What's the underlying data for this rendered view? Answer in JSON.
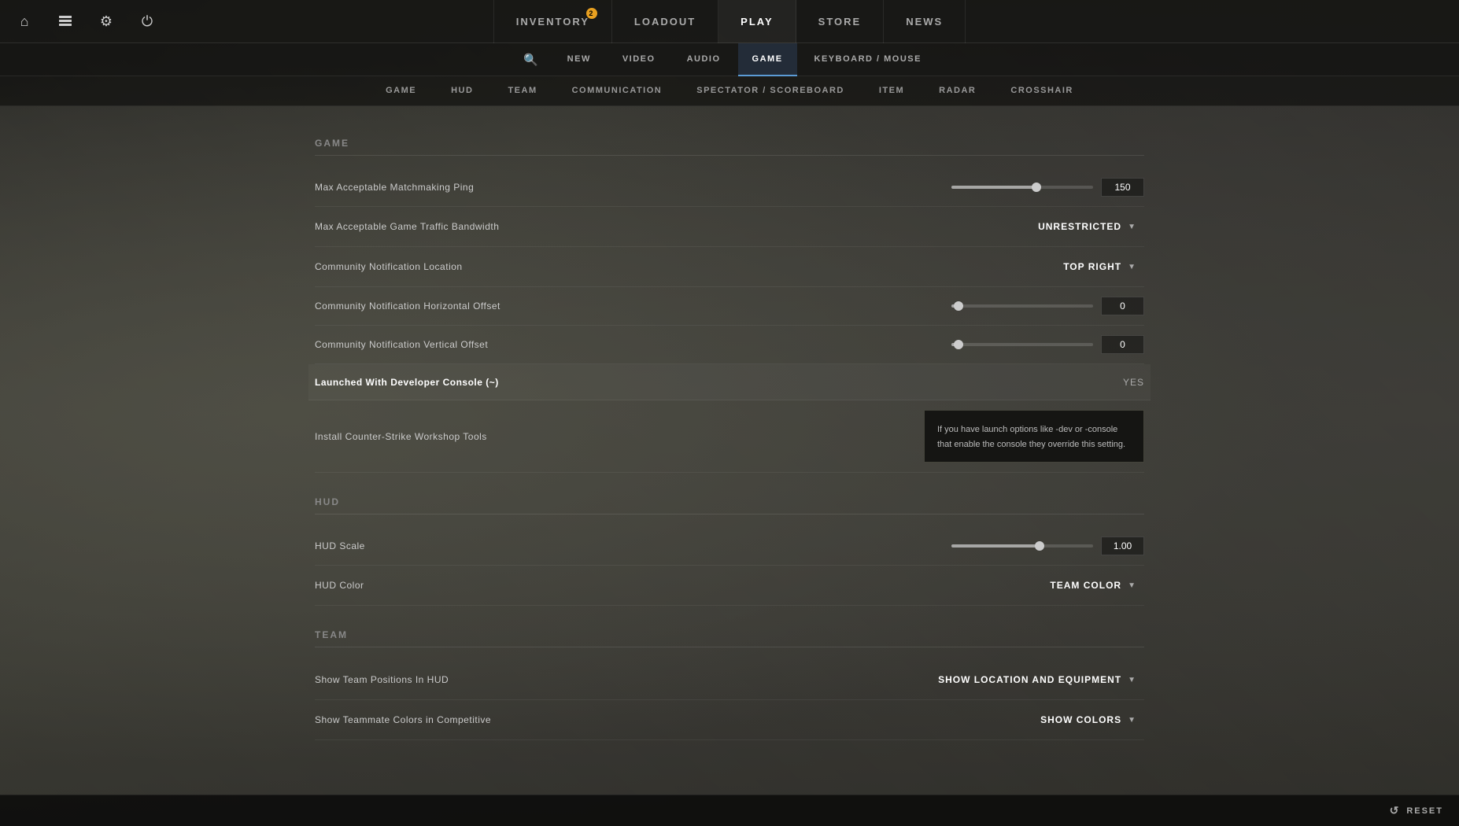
{
  "background": {
    "color": "#4a4948"
  },
  "top_nav": {
    "items": [
      {
        "id": "inventory",
        "label": "INVENTORY",
        "active": false,
        "badge": "2"
      },
      {
        "id": "loadout",
        "label": "LOADOUT",
        "active": false,
        "badge": null
      },
      {
        "id": "play",
        "label": "PLAY",
        "active": true,
        "badge": null
      },
      {
        "id": "store",
        "label": "STORE",
        "active": false,
        "badge": null
      },
      {
        "id": "news",
        "label": "NEWS",
        "active": false,
        "badge": null
      }
    ],
    "icons": {
      "home": "⌂",
      "clipboard": "📋",
      "gear": "⚙",
      "power": "⏻"
    }
  },
  "settings_tabs": {
    "items": [
      {
        "id": "new",
        "label": "NEW",
        "active": false
      },
      {
        "id": "video",
        "label": "VIDEO",
        "active": false
      },
      {
        "id": "audio",
        "label": "AUDIO",
        "active": false
      },
      {
        "id": "game",
        "label": "GAME",
        "active": true
      },
      {
        "id": "keyboard_mouse",
        "label": "KEYBOARD / MOUSE",
        "active": false
      }
    ],
    "search_icon": "🔍"
  },
  "sub_nav": {
    "items": [
      {
        "id": "game",
        "label": "GAME",
        "active": false
      },
      {
        "id": "hud",
        "label": "HUD",
        "active": false
      },
      {
        "id": "team",
        "label": "TEAM",
        "active": false
      },
      {
        "id": "communication",
        "label": "COMMUNICATION",
        "active": false
      },
      {
        "id": "spectator_scoreboard",
        "label": "SPECTATOR / SCOREBOARD",
        "active": false
      },
      {
        "id": "item",
        "label": "ITEM",
        "active": false
      },
      {
        "id": "radar",
        "label": "RADAR",
        "active": false
      },
      {
        "id": "crosshair",
        "label": "CROSSHAIR",
        "active": false
      }
    ]
  },
  "sections": {
    "game": {
      "label": "Game",
      "settings": [
        {
          "id": "matchmaking_ping",
          "name": "Max Acceptable Matchmaking Ping",
          "type": "slider",
          "value": "150",
          "slider_percent": 60
        },
        {
          "id": "traffic_bandwidth",
          "name": "Max Acceptable Game Traffic Bandwidth",
          "type": "dropdown",
          "value": "UNRESTRICTED"
        },
        {
          "id": "notification_location",
          "name": "Community Notification Location",
          "type": "dropdown",
          "value": "TOP RIGHT"
        },
        {
          "id": "notification_h_offset",
          "name": "Community Notification Horizontal Offset",
          "type": "slider",
          "value": "0",
          "slider_percent": 5
        },
        {
          "id": "notification_v_offset",
          "name": "Community Notification Vertical Offset",
          "type": "slider",
          "value": "0",
          "slider_percent": 5
        },
        {
          "id": "developer_console",
          "name": "Launched With Developer Console (~)",
          "type": "value",
          "value": "YES",
          "bold": true
        },
        {
          "id": "workshop_tools",
          "name": "Install Counter-Strike Workshop Tools",
          "type": "install",
          "tooltip": "If you have launch options like -dev or -console that enable the console they override this setting."
        }
      ]
    },
    "hud": {
      "label": "Hud",
      "settings": [
        {
          "id": "hud_scale",
          "name": "HUD Scale",
          "type": "slider",
          "value": "1.00",
          "slider_percent": 62
        },
        {
          "id": "hud_color",
          "name": "HUD Color",
          "type": "dropdown",
          "value": "TEAM COLOR"
        }
      ]
    },
    "team": {
      "label": "Team",
      "settings": [
        {
          "id": "team_positions_hud",
          "name": "Show Team Positions In HUD",
          "type": "dropdown",
          "value": "SHOW LOCATION AND EQUIPMENT"
        },
        {
          "id": "teammate_colors",
          "name": "Show Teammate Colors in Competitive",
          "type": "dropdown",
          "value": "SHOW COLORS"
        }
      ]
    }
  },
  "bottom_bar": {
    "reset_label": "RESET",
    "reset_icon": "↺"
  }
}
